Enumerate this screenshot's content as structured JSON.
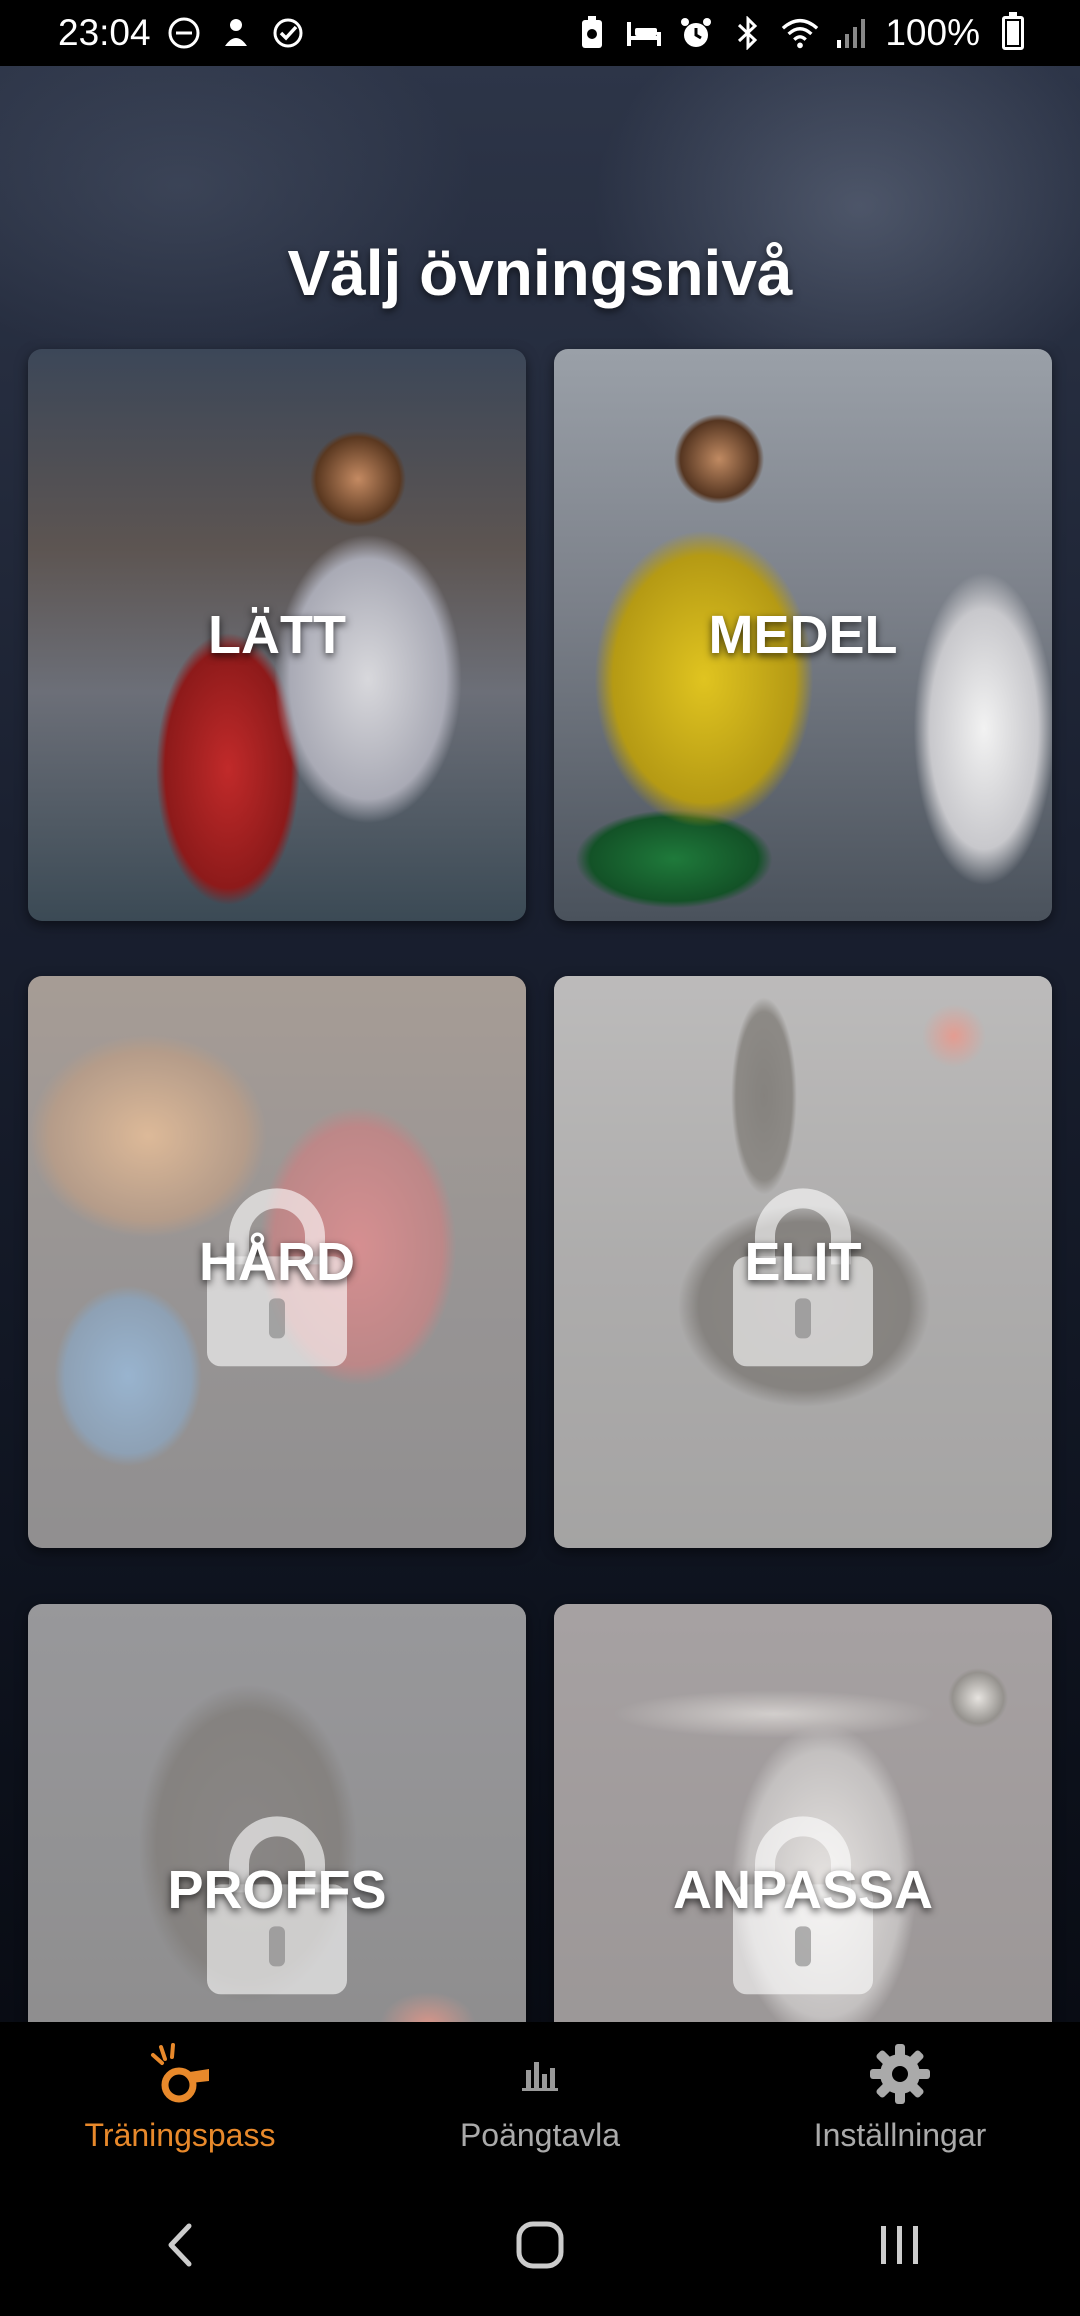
{
  "status_bar": {
    "time": "23:04",
    "battery_percent": "100%"
  },
  "page": {
    "title": "Välj övningsnivå"
  },
  "levels": [
    {
      "label": "LÄTT",
      "locked": false
    },
    {
      "label": "MEDEL",
      "locked": false
    },
    {
      "label": "HÅRD",
      "locked": true
    },
    {
      "label": "ELIT",
      "locked": true
    },
    {
      "label": "PROFFS",
      "locked": true
    },
    {
      "label": "ANPASSA",
      "locked": true
    }
  ],
  "bottom_nav": {
    "items": [
      {
        "label": "Träningspass",
        "icon": "whistle-icon",
        "active": true
      },
      {
        "label": "Poängtavla",
        "icon": "bar-chart-icon",
        "active": false
      },
      {
        "label": "Inställningar",
        "icon": "gear-icon",
        "active": false
      }
    ]
  },
  "colors": {
    "accent": "#e8892b",
    "nav_inactive": "#aaaaaa",
    "background": "#1a2030"
  }
}
